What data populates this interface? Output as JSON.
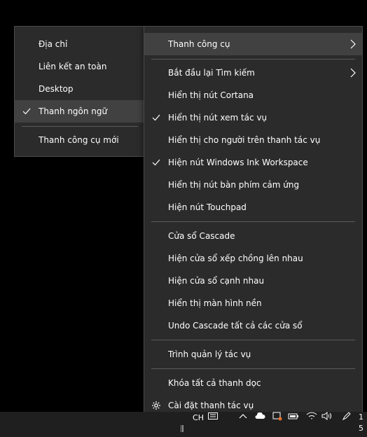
{
  "submenu": {
    "items": [
      {
        "label": "Địa chỉ",
        "checked": false
      },
      {
        "label": "Liên kết an toàn",
        "checked": false
      },
      {
        "label": "Desktop",
        "checked": false
      },
      {
        "label": "Thanh ngôn ngữ",
        "checked": true
      },
      {
        "label": "Thanh công cụ mới",
        "checked": false
      }
    ]
  },
  "menu": {
    "toolbars": "Thanh công cụ",
    "restart_search": "Bắt đầu lại Tìm kiếm",
    "show_cortana": "Hiển thị nút Cortana",
    "show_task_view": "Hiển thị nút xem tác vụ",
    "show_people": "Hiển thị cho người trên thanh tác vụ",
    "show_ink": "Hiện nút Windows Ink Workspace",
    "show_keyboard": "Hiển thị nút bàn phím cảm ứng",
    "show_touchpad": "Hiện nút Touchpad",
    "cascade": "Cửa sổ Cascade",
    "stacked": "Hiện cửa sổ xếp chồng lên nhau",
    "side_by_side": "Hiện cửa sổ cạnh nhau",
    "show_desktop": "Hiển thị màn hình nền",
    "undo_cascade": "Undo Cascade tất cả các cửa sổ",
    "task_manager": "Trình quản lý tác vụ",
    "lock_taskbars": "Khóa tất cả thanh dọc",
    "taskbar_settings": "Cài đặt thanh tác vụ"
  },
  "checked": {
    "show_task_view": true,
    "show_ink": true
  },
  "taskbar": {
    "language": "CH",
    "clock_top": "1",
    "clock_bottom": "5"
  },
  "colors": {
    "menu_bg": "#2b2b2b",
    "highlight": "#414141",
    "separator": "#5a5a5a",
    "taskbar_bg": "#1f1f1f",
    "notification_dot": "#e8702a"
  },
  "icons": [
    "check-icon",
    "chevron-right-icon",
    "gear-icon",
    "chevron-up-icon",
    "cloud-icon",
    "network-icon",
    "volume-icon",
    "pen-icon"
  ]
}
